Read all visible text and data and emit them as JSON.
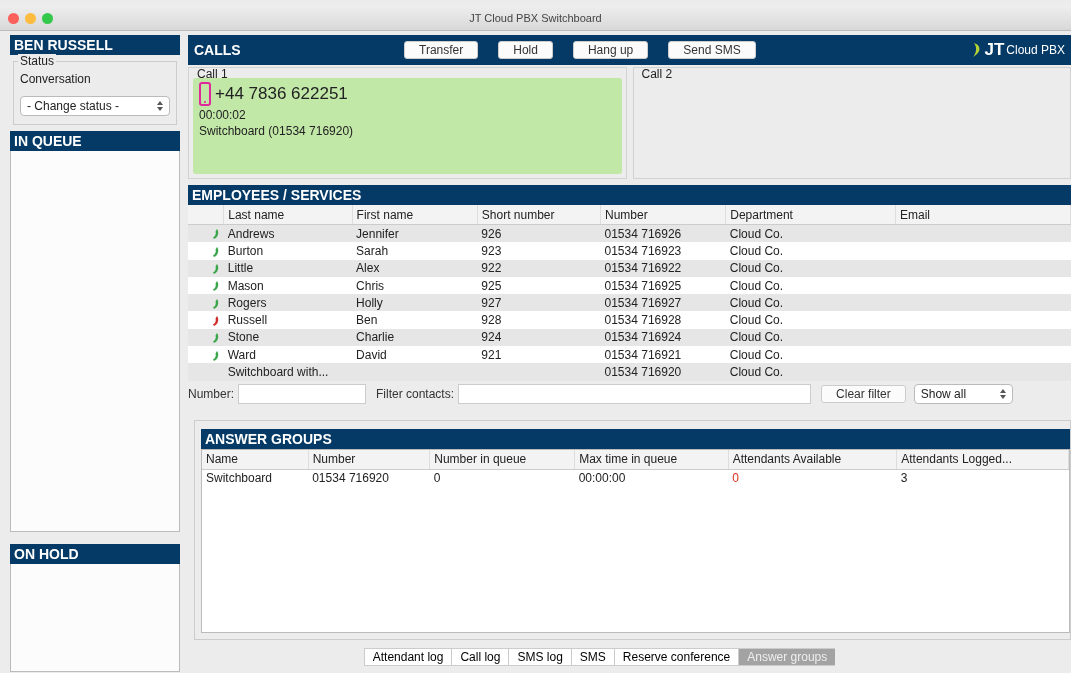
{
  "window": {
    "title": "JT Cloud PBX Switchboard"
  },
  "user": {
    "name": "BEN RUSSELL",
    "status_label": "Status",
    "status": "Conversation",
    "status_select": "- Change status -"
  },
  "in_queue": {
    "title": "IN QUEUE"
  },
  "on_hold": {
    "title": "ON HOLD"
  },
  "calls": {
    "title": "CALLS",
    "buttons": [
      "Transfer",
      "Hold",
      "Hang up",
      "Send SMS"
    ],
    "logo": {
      "mark": "JT",
      "text": "Cloud PBX"
    },
    "slots": [
      {
        "label": "Call 1",
        "active": true,
        "number": "+44 7836 622251",
        "duration": "00:00:02",
        "via": "Switchboard (01534 716920)"
      },
      {
        "label": "Call 2",
        "active": false
      }
    ]
  },
  "employees": {
    "title": "EMPLOYEES / SERVICES",
    "columns": [
      "Last name",
      "First name",
      "Short number",
      "Number",
      "Department",
      "Email"
    ],
    "rows": [
      {
        "kind": "available",
        "cells": [
          "Andrews",
          "Jennifer",
          "926",
          "01534 716926",
          "Cloud Co."
        ]
      },
      {
        "kind": "available",
        "cells": [
          "Burton",
          "Sarah",
          "923",
          "01534 716923",
          "Cloud Co."
        ]
      },
      {
        "kind": "available",
        "cells": [
          "Little",
          "Alex",
          "922",
          "01534 716922",
          "Cloud Co."
        ]
      },
      {
        "kind": "available",
        "cells": [
          "Mason",
          "Chris",
          "925",
          "01534 716925",
          "Cloud Co."
        ]
      },
      {
        "kind": "available",
        "cells": [
          "Rogers",
          "Holly",
          "927",
          "01534 716927",
          "Cloud Co."
        ]
      },
      {
        "kind": "busy",
        "cells": [
          "Russell",
          "Ben",
          "928",
          "01534 716928",
          "Cloud Co."
        ]
      },
      {
        "kind": "available",
        "cells": [
          "Stone",
          "Charlie",
          "924",
          "01534 716924",
          "Cloud Co."
        ]
      },
      {
        "kind": "available",
        "cells": [
          "Ward",
          "David",
          "921",
          "01534 716921",
          "Cloud Co."
        ]
      },
      {
        "kind": "service",
        "cells": [
          "Switchboard with...",
          "",
          "",
          "01534 716920",
          "Cloud Co."
        ]
      }
    ],
    "number_label": "Number:",
    "filter_label": "Filter contacts:",
    "clear_button": "Clear filter",
    "show_select": "Show all"
  },
  "answer_groups": {
    "title": "ANSWER GROUPS",
    "columns": [
      "Name",
      "Number",
      "Number in queue",
      "Max time in queue",
      "Attendants Available",
      "Attendants Logged..."
    ],
    "rows": [
      {
        "cells": [
          {
            "text": "Switchboard",
            "alert": false
          },
          {
            "text": "01534 716920",
            "alert": false
          },
          {
            "text": "0",
            "alert": false
          },
          {
            "text": "00:00:00",
            "alert": false
          },
          {
            "text": "0",
            "alert": true
          },
          {
            "text": "3",
            "alert": false
          }
        ]
      }
    ]
  },
  "tabs": [
    {
      "label": "Attendant log",
      "selected": false
    },
    {
      "label": "Call log",
      "selected": false
    },
    {
      "label": "SMS log",
      "selected": false
    },
    {
      "label": "SMS",
      "selected": false
    },
    {
      "label": "Reserve conference",
      "selected": false
    },
    {
      "label": "Answer groups",
      "selected": true
    }
  ]
}
